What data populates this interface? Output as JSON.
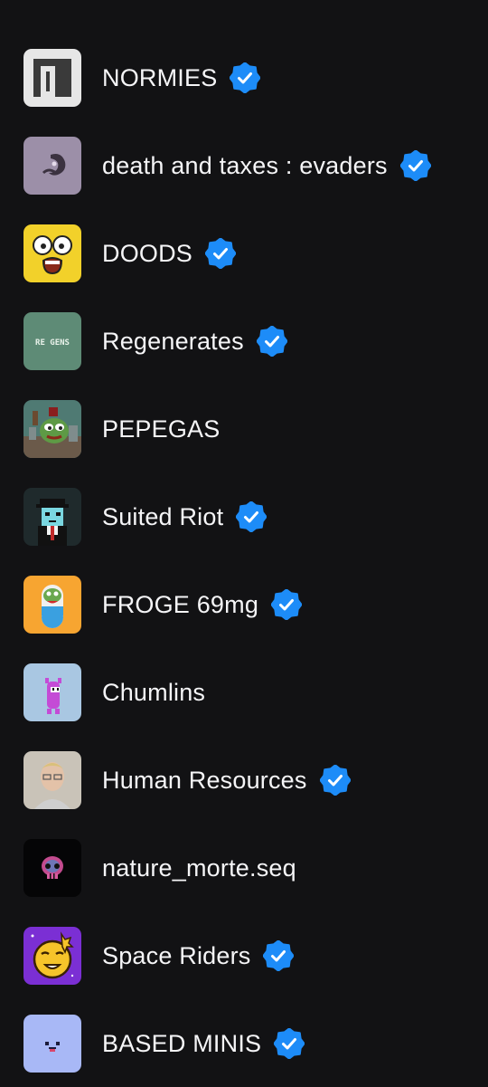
{
  "colors": {
    "background": "#121214",
    "text": "#f5f5f7",
    "verified": "#1d8cf8"
  },
  "collections": [
    {
      "name": "NORMIES",
      "verified": true,
      "icon": "normies-avatar-icon"
    },
    {
      "name": "death and taxes : evaders",
      "verified": true,
      "icon": "death-and-taxes-avatar-icon"
    },
    {
      "name": "DOODS",
      "verified": true,
      "icon": "doods-avatar-icon"
    },
    {
      "name": "Regenerates",
      "verified": true,
      "icon": "regenerates-avatar-icon"
    },
    {
      "name": "PEPEGAS",
      "verified": false,
      "icon": "pepegas-avatar-icon"
    },
    {
      "name": "Suited Riot",
      "verified": true,
      "icon": "suited-riot-avatar-icon"
    },
    {
      "name": "FROGE 69mg",
      "verified": true,
      "icon": "froge-avatar-icon"
    },
    {
      "name": "Chumlins",
      "verified": false,
      "icon": "chumlins-avatar-icon"
    },
    {
      "name": "Human Resources",
      "verified": true,
      "icon": "human-resources-avatar-icon"
    },
    {
      "name": "nature_morte.seq",
      "verified": false,
      "icon": "nature-morte-avatar-icon"
    },
    {
      "name": "Space Riders",
      "verified": true,
      "icon": "space-riders-avatar-icon"
    },
    {
      "name": "BASED MINIS",
      "verified": true,
      "icon": "based-minis-avatar-icon"
    }
  ],
  "logo_text": {
    "regenerates": "RE GENS"
  }
}
